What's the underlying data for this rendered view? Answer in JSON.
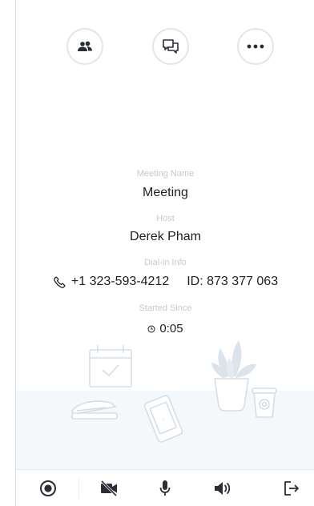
{
  "meeting": {
    "name_label": "Meeting Name",
    "name": "Meeting",
    "host_label": "Host",
    "host": "Derek Pham",
    "dialin_label": "Dial-in Info",
    "dialin_number": "+1 323-593-4212",
    "meeting_id": "ID: 873 377 063",
    "started_label": "Started Since",
    "elapsed": "0:05"
  },
  "top_actions": [
    {
      "icon": "participants-icon"
    },
    {
      "icon": "chat-icon"
    },
    {
      "icon": "more-icon"
    }
  ],
  "toolbar": [
    {
      "icon": "record-icon"
    },
    {
      "icon": "video-off-icon"
    },
    {
      "icon": "microphone-icon"
    },
    {
      "icon": "speaker-icon"
    },
    {
      "icon": "leave-icon"
    }
  ],
  "colors": {
    "text": "#1c1f23",
    "label": "#c5c9ce",
    "icon": "#2b2f35",
    "border": "#e3e6ea",
    "illustration": "#d5dde6",
    "desk": "#f5f8fb"
  }
}
